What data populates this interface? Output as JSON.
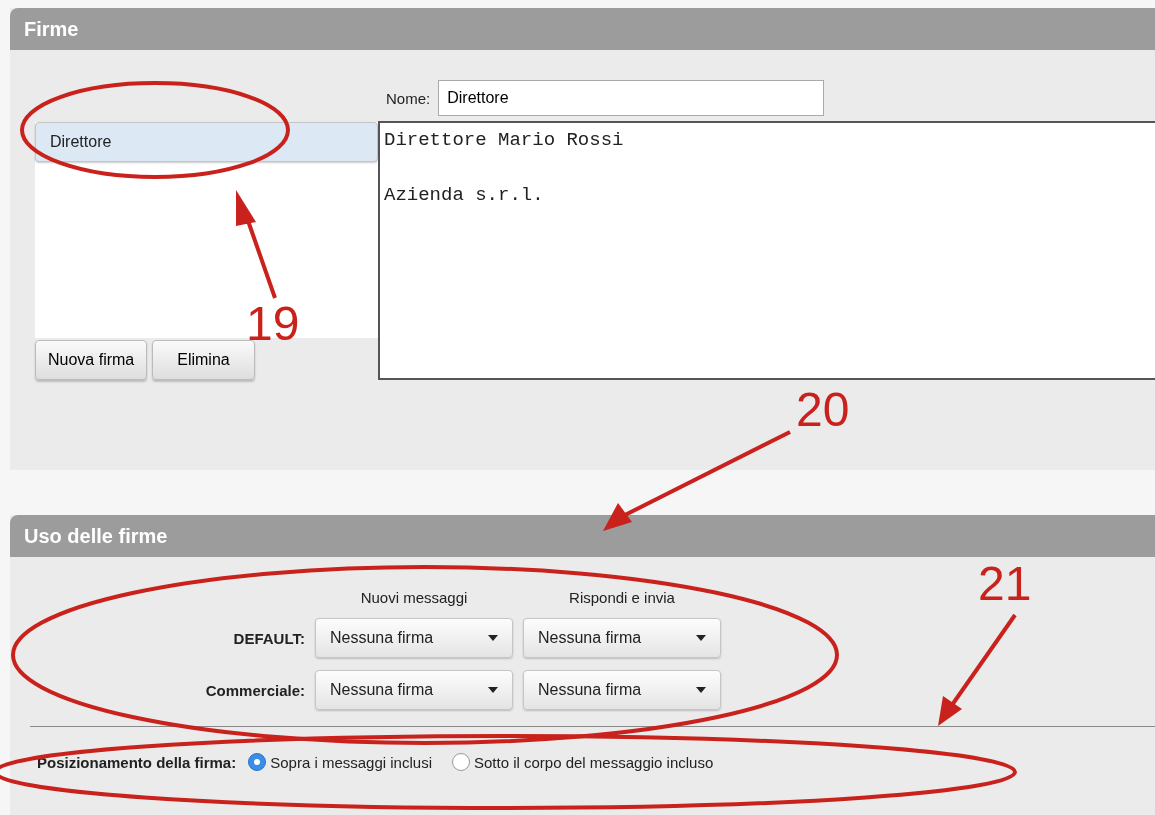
{
  "signatures": {
    "title": "Firme",
    "list": [
      {
        "label": "Direttore",
        "selected": true
      }
    ],
    "name_label": "Nome:",
    "name_value": "Direttore",
    "body_lines": [
      "Direttore Mario Rossi",
      "Azienda s.r.l."
    ],
    "buttons": [
      "Nuova firma",
      "Elimina"
    ]
  },
  "usage": {
    "title": "Uso delle firme",
    "columns": [
      "Nuovi messaggi",
      "Rispondi e invia"
    ],
    "rows": [
      {
        "label": "DEFAULT:",
        "values": [
          "Nessuna firma",
          "Nessuna firma"
        ]
      },
      {
        "label": "Commerciale:",
        "values": [
          "Nessuna firma",
          "Nessuna firma"
        ]
      }
    ],
    "position_label": "Posizionamento della firma:",
    "position_options": [
      {
        "label": "Sopra i messaggi inclusi",
        "selected": true
      },
      {
        "label": "Sotto il corpo del messaggio incluso",
        "selected": false
      }
    ]
  },
  "annotations": [
    {
      "label": "19"
    },
    {
      "label": "20"
    },
    {
      "label": "21"
    }
  ]
}
